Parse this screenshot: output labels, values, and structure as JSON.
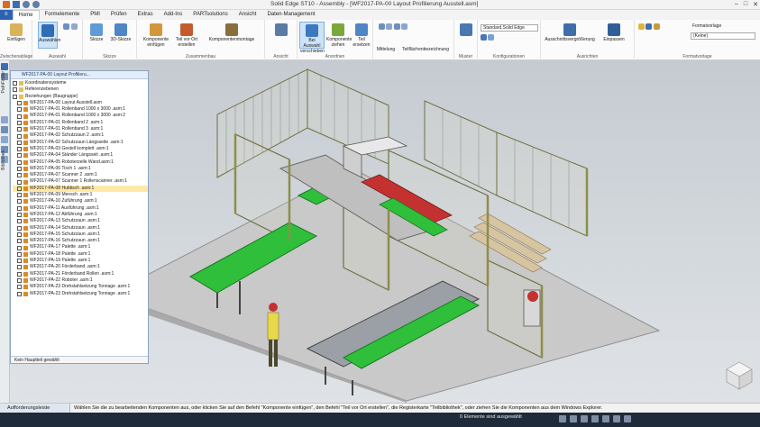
{
  "titlebar": {
    "title": "Solid Edge ST10 - Assembly - [WF2017-PA-00 Layout Profilierung Ausstell.asm]",
    "icons": [
      "save-icon",
      "undo-icon",
      "redo-icon"
    ]
  },
  "tabs": [
    {
      "label": "Home",
      "active": true
    },
    {
      "label": "Formelemente"
    },
    {
      "label": "PMI"
    },
    {
      "label": "Prüfen"
    },
    {
      "label": "Extras"
    },
    {
      "label": "Add-Ins"
    },
    {
      "label": "PARTsolutions"
    },
    {
      "label": "Ansicht"
    },
    {
      "label": "Daten-Management"
    }
  ],
  "ribbon": {
    "groups": {
      "zwischenablage": "Zwischenablage",
      "auswahl": "Auswahl",
      "skizze": "Skizze",
      "zusammenbau": "Zusammenbau",
      "ansicht": "Ansicht",
      "ansicht2": "Anordnen",
      "muster": "Muster",
      "konfigurationen": "Konfigurationen",
      "ausrichten": "Ausrichten",
      "formatvorlage": "Formatvorlage"
    },
    "buttons": {
      "einfuegen": "Einfügen",
      "auswaehlen": "Auswählen",
      "skizze": "Skizze",
      "skizze3d": "3D-Skizze",
      "komponente": "Komponente einfügen",
      "teil_vor_ort": "Teil vor Ort erstellen",
      "komponentenmontage": "Komponentenmontage",
      "bei_auswahl": "Bei Auswahl verschieben",
      "komponente_ziehen": "Komponente ziehen",
      "teil": "Teil ersetzen",
      "mittelung": "Mittelung",
      "teilflaechen": "Teilflächenbezeichnung",
      "muster": "Muster",
      "ausschnitt": "Ausschnittsvergrößerung",
      "einpassen": "Einpassen"
    },
    "combos": {
      "config": "Standard,Solid Edge",
      "formatvorlage": "Formatvorlage",
      "keine": "(Keine)"
    }
  },
  "pathfinder": {
    "header": "WF2017-PA-00 Layout Profilieru...",
    "footer": "Kein Hauptteil gewählt",
    "items": [
      {
        "label": "Koordinatensysteme"
      },
      {
        "label": "Referenzebenen"
      },
      {
        "label": "Beziehungen (Baugruppe)"
      },
      {
        "label": "WF2017-PA-00 Layout Ausstell.asm"
      },
      {
        "label": "WF2017-PA-01 Rollenband 1000 x 3000 .asm:1"
      },
      {
        "label": "WF2017-PA-01 Rollenband 1000 x 3000 .asm:2"
      },
      {
        "label": "WF2017-PA-01 Rollenband 2 .asm:1"
      },
      {
        "label": "WF2017-PA-01 Rollenband 3 .asm:1"
      },
      {
        "label": "WF2017-PA-02 Schutzzaun 2 .asm:1"
      },
      {
        "label": "WF2017-PA-02 Schutzzaun Längsseite .asm:1"
      },
      {
        "label": "WF2017-PA-03 Gestell komplett .asm:1"
      },
      {
        "label": "WF2017-PA-04 Ständer Längsseit .asm:1"
      },
      {
        "label": "WF2017-PA-05 Roboterzelle Wand.asm:1"
      },
      {
        "label": "WF2017-PA-06 Tisch 1 .asm:1"
      },
      {
        "label": "WF2017-PA-07 Scanner 2 .asm:1"
      },
      {
        "label": "WF2017-PA-07 Scanner 1 Rollenscanner .asm:1"
      },
      {
        "label": "WF2017-PA-08 Hubtisch .asm:1",
        "selected": true
      },
      {
        "label": "WF2017-PA-09 Mensch .asm:1"
      },
      {
        "label": "WF2017-PA-10 Zuführung .asm:1"
      },
      {
        "label": "WF2017-PA-11 Ausführung .asm:1"
      },
      {
        "label": "WF2017-PA-12 Abführung .asm:1"
      },
      {
        "label": "WF2017-PA-13 Schutzzaun .asm:1"
      },
      {
        "label": "WF2017-PA-14 Schutzzaun .asm:1"
      },
      {
        "label": "WF2017-PA-15 Schutzzaun .asm:1"
      },
      {
        "label": "WF2017-PA-16 Schutzzaun .asm:1"
      },
      {
        "label": "WF2017-PA-17 Palette .asm:1"
      },
      {
        "label": "WF2017-PA-18 Palette .asm:1"
      },
      {
        "label": "WF2017-PA-19 Palette .asm:1"
      },
      {
        "label": "WF2017-PA-20 Förderband .asm:1"
      },
      {
        "label": "WF2017-PA-21 Förderband Rollen .asm:1"
      },
      {
        "label": "WF2017-PA-22 Roboter .asm:1"
      },
      {
        "label": "WF2017-PA-23 Drehstahlsetzung Tonnage .asm:1"
      },
      {
        "label": "WF2017-PA-23 Drehstahlsetzung Tonnage .asm:1"
      }
    ]
  },
  "sidestrip": {
    "label_top": "PathFinder",
    "label_bottom": "Bibliothek"
  },
  "prompt": {
    "tab": "Aufforderungsleiste",
    "text": "Wählen Sie die zu bearbeitenden Komponenten aus, oder klicken Sie auf den Befehl \"Komponente einfügen\", den Befehl \"Teil vor Ort erstellen\", die Registerkarte \"Teilbibliothek\", oder ziehen Sie die Komponenten aus dem Windows Explorer."
  },
  "status": {
    "text": "0 Elemente sind ausgewählt"
  },
  "colors": {
    "brand_tab": "#2d62b0",
    "conveyor_green": "#2fbf3a",
    "frame_olive": "#8d8f4a",
    "floor_grey": "#c9c9c9",
    "robot_red": "#c43131"
  }
}
